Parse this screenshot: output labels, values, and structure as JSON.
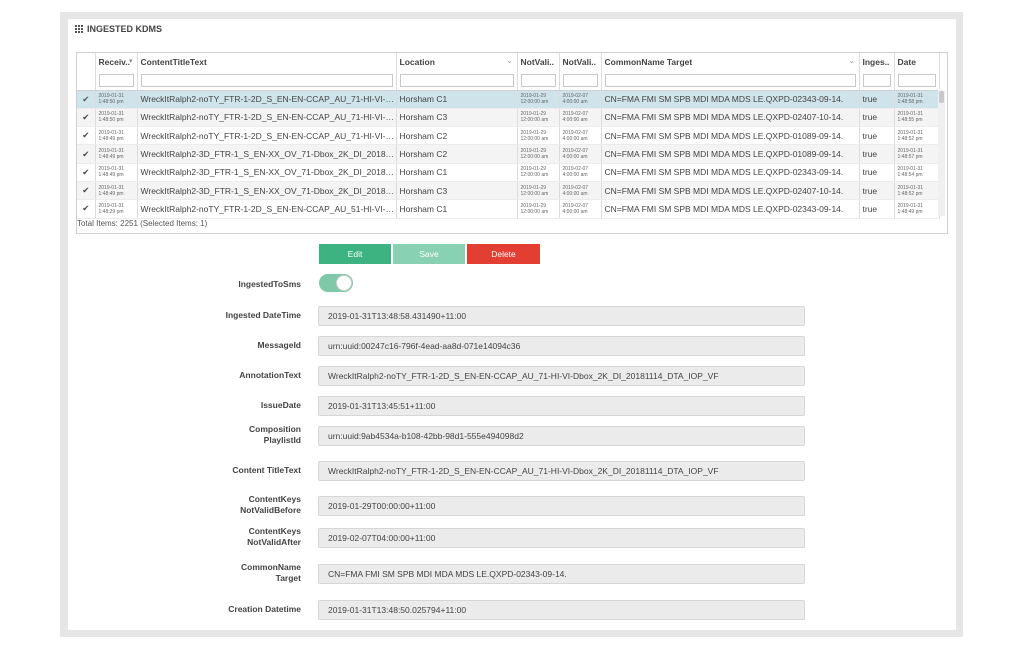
{
  "panel": {
    "title": "INGESTED KDMS"
  },
  "grid": {
    "columns": [
      "Receiv..",
      "ContentTitleText",
      "Location",
      "NotVali..",
      "NotVali..",
      "CommonName Target",
      "Inges..",
      "Date"
    ],
    "rows": [
      {
        "received": "2019-01-31 1:48:50 pm",
        "title": "WreckItRalph2-noTY_FTR-1-2D_S_EN-EN-CCAP_AU_71-HI-VI-D...",
        "location": "Horsham C1",
        "nvb": "2019-01-29 12:00:00 am",
        "nva": "2019-02-07 4:00:00 am",
        "cn": "CN=FMA FMI SM SPB MDI MDA MDS LE.QXPD-02343-09-14.",
        "ingested": "true",
        "date": "2019-01-31 1:48:58 pm"
      },
      {
        "received": "2019-01-31 1:48:50 pm",
        "title": "WreckItRalph2-noTY_FTR-1-2D_S_EN-EN-CCAP_AU_71-HI-VI-D...",
        "location": "Horsham C3",
        "nvb": "2019-01-29 12:00:00 am",
        "nva": "2019-02-07 4:00:00 am",
        "cn": "CN=FMA FMI SM SPB MDI MDA MDS LE.QXPD-02407-10-14.",
        "ingested": "true",
        "date": "2019-01-31 1:48:55 pm"
      },
      {
        "received": "2019-01-31 1:48:49 pm",
        "title": "WreckItRalph2-noTY_FTR-1-2D_S_EN-EN-CCAP_AU_71-HI-VI-D...",
        "location": "Horsham C2",
        "nvb": "2019-01-29 12:00:00 am",
        "nva": "2019-02-07 4:00:00 am",
        "cn": "CN=FMA FMI SM SPB MDI MDA MDS LE.QXPD-01089-09-14.",
        "ingested": "true",
        "date": "2019-01-31 1:48:52 pm"
      },
      {
        "received": "2019-01-31 1:48:49 pm",
        "title": "WreckItRalph2-3D_FTR-1_S_EN-XX_OV_71-Dbox_2K_DI_201810...",
        "location": "Horsham C2",
        "nvb": "2019-01-29 12:00:00 am",
        "nva": "2019-02-07 4:00:00 am",
        "cn": "CN=FMA FMI SM SPB MDI MDA MDS LE.QXPD-01089-09-14.",
        "ingested": "true",
        "date": "2019-01-31 1:48:57 pm"
      },
      {
        "received": "2019-01-31 1:48:49 pm",
        "title": "WreckItRalph2-3D_FTR-1_S_EN-XX_OV_71-Dbox_2K_DI_201810...",
        "location": "Horsham C1",
        "nvb": "2019-01-29 12:00:00 am",
        "nva": "2019-02-07 4:00:00 am",
        "cn": "CN=FMA FMI SM SPB MDI MDA MDS LE.QXPD-02343-09-14.",
        "ingested": "true",
        "date": "2019-01-31 1:48:54 pm"
      },
      {
        "received": "2019-01-31 1:48:49 pm",
        "title": "WreckItRalph2-3D_FTR-1_S_EN-XX_OV_71-Dbox_2K_DI_201810...",
        "location": "Horsham C3",
        "nvb": "2019-01-29 12:00:00 am",
        "nva": "2019-02-07 4:00:00 am",
        "cn": "CN=FMA FMI SM SPB MDI MDA MDS LE.QXPD-02407-10-14.",
        "ingested": "true",
        "date": "2019-01-31 1:48:52 pm"
      },
      {
        "received": "2019-01-31 1:48:29 pm",
        "title": "WreckItRalph2-noTY_FTR-1-2D_S_EN-EN-CCAP_AU_51-HI-VI-D...",
        "location": "Horsham C1",
        "nvb": "2019-01-29 12:00:00 am",
        "nva": "2019-02-07 4:00:00 am",
        "cn": "CN=FMA FMI SM SPB MDI MDA MDS LE.QXPD-02343-09-14.",
        "ingested": "true",
        "date": "2019-01-31 1:48:49 pm"
      }
    ],
    "selected_index": 0,
    "total": "Total Items: 2251 (Selected Items: 1)"
  },
  "buttons": {
    "edit": "Edit",
    "save": "Save",
    "delete": "Delete"
  },
  "form": {
    "ingested_to_sms_label": "IngestedToSms",
    "ingested_to_sms": true,
    "fields": [
      {
        "label": "Ingested DateTime",
        "value": "2019-01-31T13:48:58.431490+11:00"
      },
      {
        "label": "MessageId",
        "value": "urn:uuid:00247c16-796f-4ead-aa8d-071e14094c36"
      },
      {
        "label": "AnnotationText",
        "value": "WreckItRalph2-noTY_FTR-1-2D_S_EN-EN-CCAP_AU_71-HI-VI-Dbox_2K_DI_20181114_DTA_IOP_VF"
      },
      {
        "label": "IssueDate",
        "value": "2019-01-31T13:45:51+11:00"
      },
      {
        "label": "Composition\nPlaylistId",
        "value": "urn:uuid:9ab4534a-b108-42bb-98d1-555e494098d2"
      },
      {
        "label": "Content TitleText",
        "value": "WreckItRalph2-noTY_FTR-1-2D_S_EN-EN-CCAP_AU_71-HI-VI-Dbox_2K_DI_20181114_DTA_IOP_VF"
      },
      {
        "label": "ContentKeys\nNotValidBefore",
        "value": "2019-01-29T00:00:00+11:00"
      },
      {
        "label": "ContentKeys\nNotValidAfter",
        "value": "2019-02-07T04:00:00+11:00"
      },
      {
        "label": "CommonName\nTarget",
        "value": "CN=FMA FMI SM SPB MDI MDA MDS LE.QXPD-02343-09-14."
      },
      {
        "label": "Creation Datetime",
        "value": "2019-01-31T13:48:50.025794+11:00"
      }
    ]
  }
}
